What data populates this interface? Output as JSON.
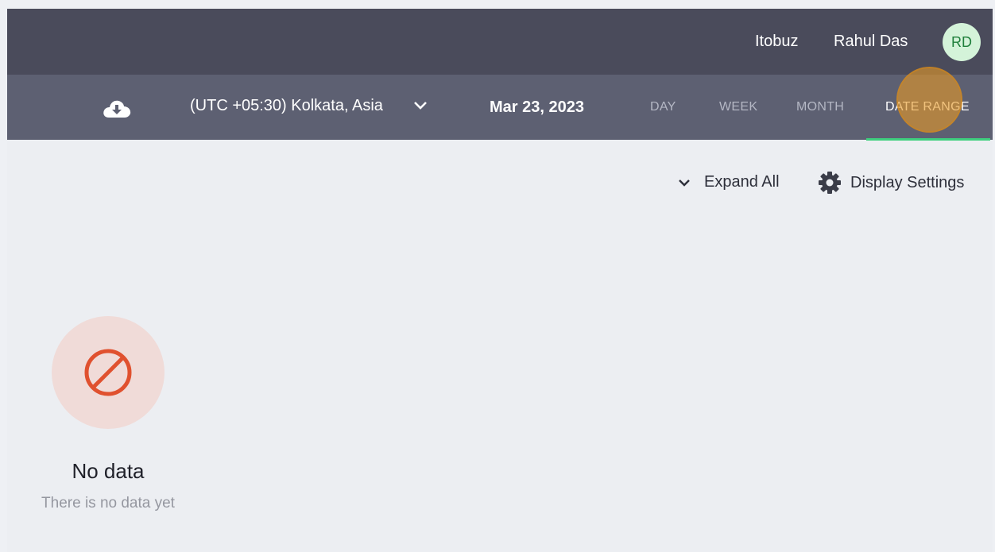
{
  "header": {
    "org_name": "Itobuz",
    "user_name": "Rahul Das",
    "avatar_initials": "RD"
  },
  "toolbar": {
    "download_icon": "cloud-download-icon",
    "timezone": "(UTC +05:30) Kolkata, Asia",
    "date": "Mar 23, 2023",
    "tabs": [
      {
        "label": "DAY",
        "active": false
      },
      {
        "label": "WEEK",
        "active": false
      },
      {
        "label": "MONTH",
        "active": false
      },
      {
        "label": "DATE RANGE",
        "active": true
      }
    ]
  },
  "actions": {
    "expand_all": "Expand All",
    "display_settings": "Display Settings"
  },
  "empty_state": {
    "icon": "no-entry-icon",
    "title": "No data",
    "subtitle": "There is no data yet"
  },
  "colors": {
    "topbar": "#4a4b5b",
    "subbar": "#5d6072",
    "active_underline": "#3ecf7e",
    "empty_icon": "#e0512f",
    "avatar_bg": "#d4f3d9"
  }
}
